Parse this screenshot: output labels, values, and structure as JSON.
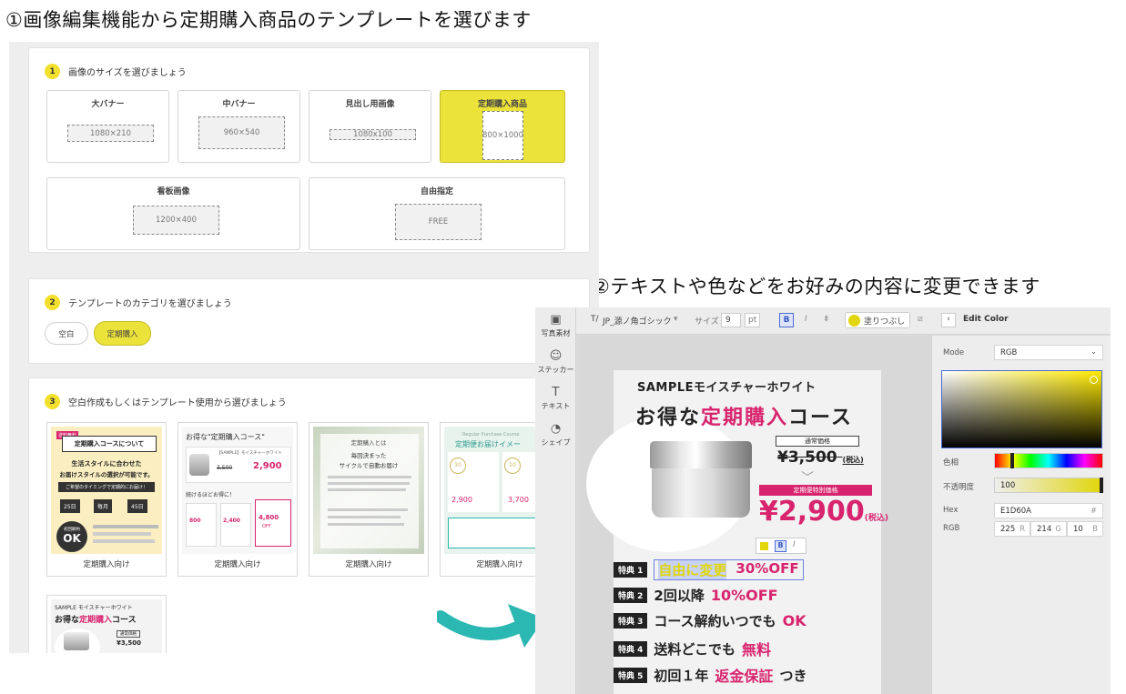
{
  "headings": {
    "step1": "①画像編集機能から定期購入商品のテンプレートを選びます",
    "step2": "②テキストや色などをお好みの内容に変更できます"
  },
  "selector": {
    "section1": {
      "number": "1",
      "title": "画像のサイズを選びましょう",
      "sizes": [
        {
          "label": "大バナー",
          "dims": "1080×210"
        },
        {
          "label": "中バナー",
          "dims": "960×540"
        },
        {
          "label": "見出し用画像",
          "dims": "1080x100"
        },
        {
          "label": "定期購入商品",
          "dims": "800×1000"
        },
        {
          "label": "看板画像",
          "dims": "1200×400"
        },
        {
          "label": "自由指定",
          "dims": "FREE"
        }
      ]
    },
    "section2": {
      "number": "2",
      "title": "テンプレートのカテゴリを選びましょう",
      "categories": [
        "空白",
        "定期購入"
      ]
    },
    "section3": {
      "number": "3",
      "title": "空白作成もしくはテンプレート使用から選びましょう",
      "card_label": "定期購入向け",
      "t1": {
        "tag": "送料無料",
        "title": "定期購入コースについて",
        "line1": "生活スタイルに合わせた",
        "line2": "お届けスタイルの選択が可能です。",
        "bar": "ご希望のタイミングで定期的にお届け！",
        "days": [
          "25日",
          "毎月",
          "45日"
        ],
        "ok_top": "初回解約",
        "ok": "OK"
      },
      "t2": {
        "title": "お得な\"定期購入コース\"",
        "product": "【SAMPLE】モイスチャーホワイト",
        "old": "3,500",
        "new": "2,900",
        "mid": "続けるほどお得に！",
        "prices": [
          "800",
          "2,400",
          "4,800"
        ],
        "off": "OFF"
      },
      "t3": {
        "title": "定期購入とは",
        "line1": "毎回決まった",
        "line2": "サイクルで自動お届け"
      },
      "t4": {
        "sub": "Regular Purchase Course",
        "title": "定期便お届けイメー",
        "c1": "30",
        "c2": "10",
        "p1": "2,900",
        "p2": "3,700"
      },
      "t5": {
        "brand": "SAMPLE モイスチャーホワイト",
        "title_a": "お得な",
        "title_b": "定期購入",
        "title_c": "コース",
        "price_label": "通常価格",
        "price": "¥3,500"
      }
    }
  },
  "editor": {
    "tools": [
      {
        "icon": "▣",
        "label": "写真素材"
      },
      {
        "icon": "☺",
        "label": "ステッカー"
      },
      {
        "icon": "T",
        "label": "テキスト"
      },
      {
        "icon": "◔",
        "label": "シェイプ"
      }
    ],
    "toolbar": {
      "font_icon": "T/",
      "font": "JP_源ノ角ゴシック",
      "size_label": "サイズ",
      "size": "9",
      "unit": "pt",
      "bold": "B",
      "italic": "I",
      "fill": "塗りつぶし",
      "title": "Edit Color"
    },
    "canvas": {
      "brand": "SAMPLEモイスチャーホワイト",
      "headline_a": "お得な",
      "headline_b": "定期購入",
      "headline_c": "コース",
      "normal_label": "通常価格",
      "normal_price": "¥3,500",
      "normal_tax": "(税込)",
      "special_label": "定期便特別価格",
      "special_price": "¥2,900",
      "special_tax": "(税込)",
      "mini_b": "B",
      "mini_i": "I",
      "perks": [
        {
          "badge": "特典 1",
          "a": "自由に変更",
          "b": "30%OFF"
        },
        {
          "badge": "特典 2",
          "a": "2回以降",
          "b": "10%OFF"
        },
        {
          "badge": "特典 3",
          "a": "コース解約いつでも",
          "b": "OK"
        },
        {
          "badge": "特典 4",
          "a": "送料どこでも",
          "b": "無料"
        },
        {
          "badge": "特典 5",
          "a": "初回１年",
          "b": "返金保証",
          "c": "つき"
        }
      ]
    },
    "color": {
      "mode_label": "Mode",
      "mode": "RGB",
      "hue_label": "色相",
      "opacity_label": "不透明度",
      "opacity": "100",
      "hex_label": "Hex",
      "hex": "E1D60A",
      "hash": "#",
      "rgb_label": "RGB",
      "r": "225",
      "g": "214",
      "b": "10",
      "r_l": "R",
      "g_l": "G",
      "b_l": "B",
      "current": "#E1D60A"
    }
  },
  "colors": {
    "accent_yellow": "#ece33a",
    "pink": "#d8246e",
    "teal": "#2cb8b2"
  }
}
